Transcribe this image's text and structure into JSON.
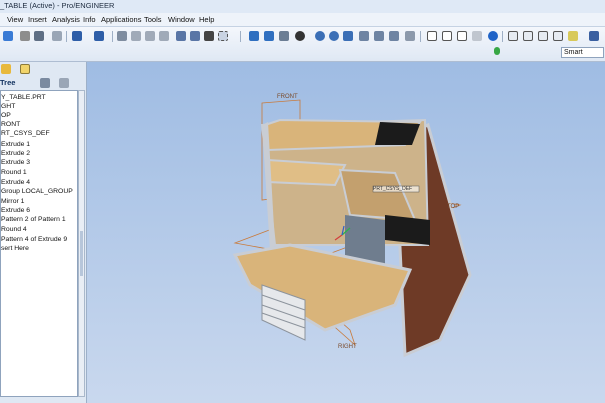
{
  "window": {
    "title": "_TABLE (Active) - Pro/ENGINEER"
  },
  "menu": [
    "View",
    "Insert",
    "Analysis",
    "Info",
    "Applications",
    "Tools",
    "Window",
    "Help"
  ],
  "search": {
    "value": "Smart"
  },
  "model_tree": {
    "title": "Tree",
    "items": [
      "Y_TABLE.PRT",
      "GHT",
      "OP",
      "RONT",
      "RT_CSYS_DEF",
      "Extrude 1",
      "Extrude 2",
      "Extrude 3",
      "Round 1",
      "Extrude 4",
      "Group LOCAL_GROUP",
      "Mirror 1",
      "Extrude 6",
      "Pattern 2 of Pattern 1",
      "Round 4",
      "Pattern 4 of Extrude 9",
      "sert Here"
    ]
  },
  "viewport": {
    "labels": {
      "front": "FRONT",
      "top": "TOP",
      "right": "RIGHT",
      "csys": "PRT_CSYS_DEF"
    },
    "colors": {
      "desk_top": "#d9b47a",
      "side_panel": "#6e3a26",
      "frame": "#c9cdd4",
      "background": "#a8c2e6"
    }
  }
}
